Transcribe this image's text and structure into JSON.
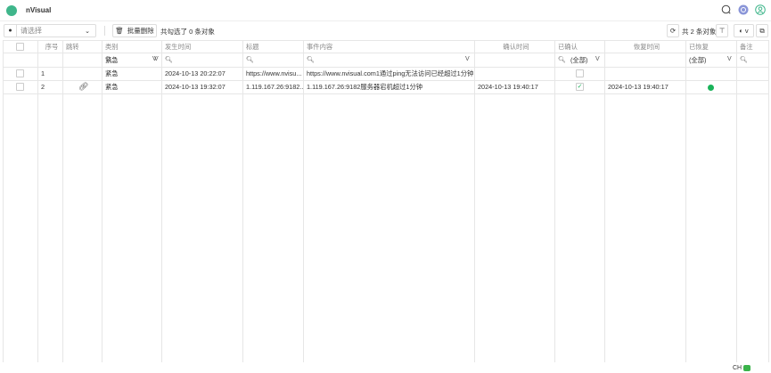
{
  "app": {
    "name": "nVisual"
  },
  "toolbar": {
    "select_placeholder": "请选择",
    "batch_delete": "批量删除",
    "selected_text": "共勾选了 0 条对象",
    "total_text": "共 2 条对象"
  },
  "columns": [
    "序号",
    "跳转",
    "类别",
    "发生时间",
    "标题",
    "事件内容",
    "确认时间",
    "已确认",
    "恢复时间",
    "已恢复",
    "备注"
  ],
  "filters": {
    "category": "紧急",
    "confirmed": "(全部)",
    "recovered": "(全部)"
  },
  "rows": [
    {
      "index": "1",
      "category": "紧急",
      "time": "2024-10-13 20:22:07",
      "title": "https://www.nvisu...",
      "content": "https://www.nvisual.com1通过ping无法访问已经超过1分钟",
      "confirm_time": "",
      "confirmed": false,
      "recover_time": "",
      "recovered": false,
      "link": false
    },
    {
      "index": "2",
      "category": "紧急",
      "time": "2024-10-13 19:32:07",
      "title": "1.119.167.26:9182...",
      "content": "1.119.167.26:9182服务器宕机超过1分钟",
      "confirm_time": "2024-10-13 19:40:17",
      "confirmed": true,
      "recover_time": "2024-10-13 19:40:17",
      "recovered": true,
      "link": true
    }
  ],
  "ime": {
    "label": "CH"
  },
  "colors": {
    "accent": "#3fb68b",
    "recovered": "#1ab35a"
  }
}
